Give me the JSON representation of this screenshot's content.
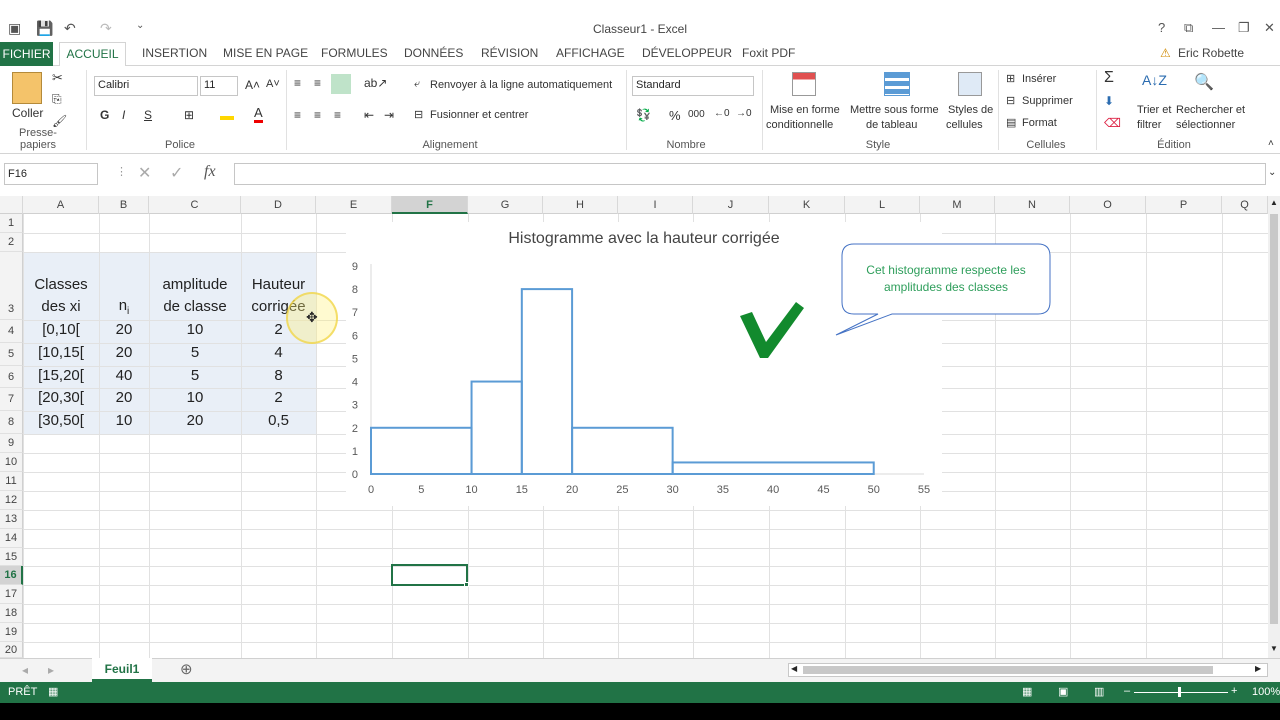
{
  "window": {
    "title": "Classeur1 - Excel",
    "help": "?",
    "user": "Eric Robette"
  },
  "tabs": [
    "FICHIER",
    "ACCUEIL",
    "INSERTION",
    "MISE EN PAGE",
    "FORMULES",
    "DONNÉES",
    "RÉVISION",
    "AFFICHAGE",
    "DÉVELOPPEUR",
    "Foxit PDF"
  ],
  "ribbon": {
    "coller": "Coller",
    "presse_papiers": "Presse-papiers",
    "font_name": "Calibri",
    "font_size": "11",
    "bold": "G",
    "italic": "I",
    "underline": "S",
    "police": "Police",
    "renvoyer": "Renvoyer à la ligne automatiquement",
    "fusionner": "Fusionner et centrer",
    "alignement": "Alignement",
    "number_format": "Standard",
    "percent": "%",
    "thousands": "000",
    "nombre": "Nombre",
    "mise_en_forme_1": "Mise en forme",
    "mise_en_forme_2": "conditionnelle",
    "mettre_sous_1": "Mettre sous forme",
    "mettre_sous_2": "de tableau",
    "styles_1": "Styles de",
    "styles_2": "cellules",
    "style": "Style",
    "inserer": "Insérer",
    "supprimer": "Supprimer",
    "format": "Format",
    "cellules": "Cellules",
    "sigma": "Σ",
    "trier_1": "Trier et",
    "trier_2": "filtrer",
    "rechercher_1": "Rechercher et",
    "rechercher_2": "sélectionner",
    "edition": "Édition"
  },
  "formula_bar": {
    "name_box": "F16",
    "fx": "fx",
    "cancel": "✕",
    "enter": "✓",
    "value": ""
  },
  "columns": [
    "A",
    "B",
    "C",
    "D",
    "E",
    "F",
    "G",
    "H",
    "I",
    "J",
    "K",
    "L",
    "M",
    "N",
    "O",
    "P",
    "Q"
  ],
  "rows": [
    "1",
    "2",
    "3",
    "4",
    "5",
    "6",
    "7",
    "8",
    "9",
    "10",
    "11",
    "12",
    "13",
    "14",
    "15",
    "16",
    "17",
    "18",
    "19",
    "20"
  ],
  "table": {
    "header_a": [
      "Classes",
      "des xi"
    ],
    "header_b": "n",
    "header_b_sub": "i",
    "header_c": [
      "amplitude",
      "de classe"
    ],
    "header_d": [
      "Hauteur",
      "corrigée"
    ],
    "rows": [
      [
        "[0,10[",
        "20",
        "10",
        "2"
      ],
      [
        "[10,15[",
        "20",
        "5",
        "4"
      ],
      [
        "[15,20[",
        "40",
        "5",
        "8"
      ],
      [
        "[20,30[",
        "20",
        "10",
        "2"
      ],
      [
        "[30,50[",
        "10",
        "20",
        "0,5"
      ]
    ]
  },
  "chart_data": {
    "type": "bar",
    "title": "Histogramme avec la hauteur corrigée",
    "bins": [
      [
        0,
        10
      ],
      [
        10,
        15
      ],
      [
        15,
        20
      ],
      [
        20,
        30
      ],
      [
        30,
        50
      ]
    ],
    "values": [
      2,
      4,
      8,
      2,
      0.5
    ],
    "xlim": [
      0,
      55
    ],
    "ylim": [
      0,
      9
    ],
    "xticks": [
      "0",
      "5",
      "10",
      "15",
      "20",
      "25",
      "30",
      "35",
      "40",
      "45",
      "50",
      "55"
    ],
    "yticks": [
      "0",
      "1",
      "2",
      "3",
      "4",
      "5",
      "6",
      "7",
      "8",
      "9"
    ],
    "grid": false,
    "colors": {
      "bars": "#5b9bd5"
    }
  },
  "callout": {
    "text_1": "Cet histogramme respecte les",
    "text_2": "amplitudes des classes",
    "color": "#2e9e5b"
  },
  "checkmark_color": "#128a2d",
  "sheet": {
    "name": "Feuil1",
    "add": "⊕"
  },
  "status": {
    "ready": "PRÊT",
    "zoom": "100%"
  },
  "colors": {
    "excel_green": "#217346"
  }
}
